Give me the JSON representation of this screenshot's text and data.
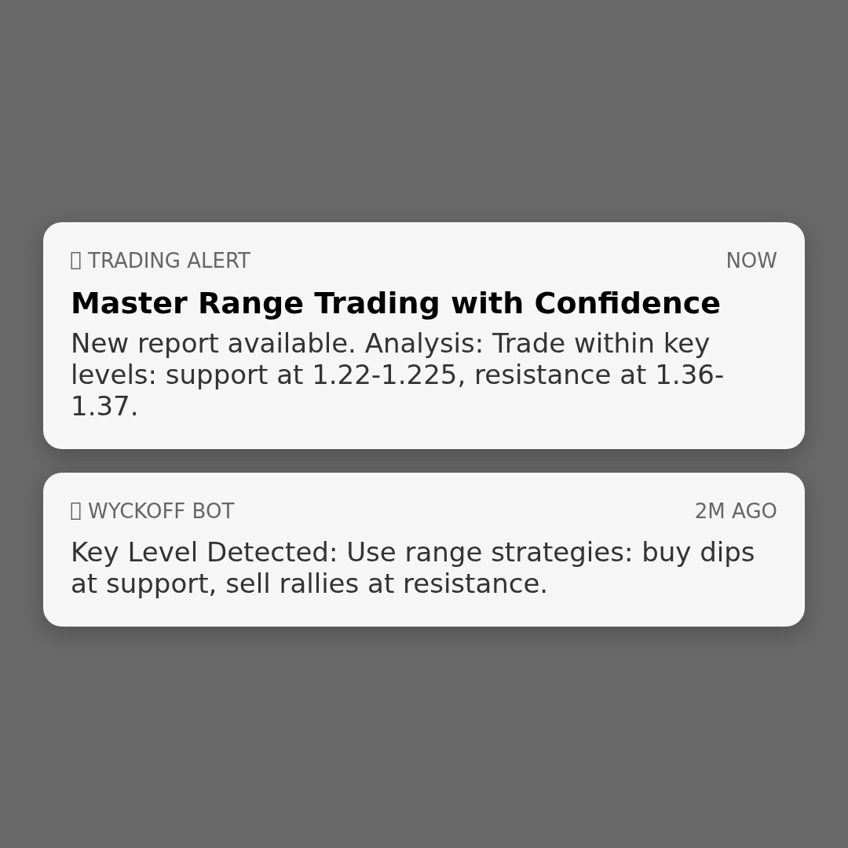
{
  "notifications": [
    {
      "app": "TRADING ALERT",
      "time": "NOW",
      "title": "Master Range Trading with Confidence",
      "body": "New report available. Analysis: Trade within key levels: support at 1.22-1.225, resistance at 1.36-1.37."
    },
    {
      "app": "WYCKOFF BOT",
      "time": "2M AGO",
      "body": "Key Level Detected: Use range strategies: buy dips at support, sell rallies at resistance."
    }
  ]
}
